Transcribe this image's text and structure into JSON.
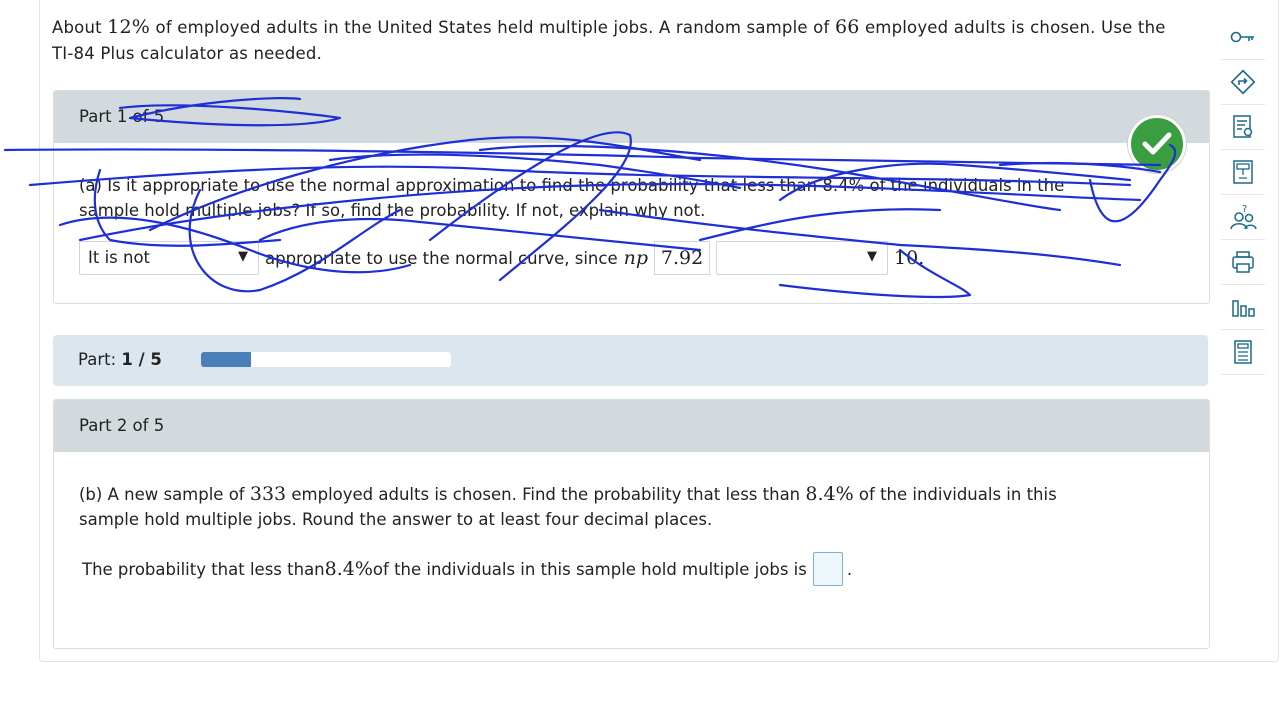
{
  "problem": {
    "intro_a": "About ",
    "pct": "12%",
    "intro_b": " of employed adults in the United States held multiple jobs. A random sample of ",
    "n": "66",
    "intro_c": " employed adults is chosen. Use the",
    "intro_d": "TI-84 Plus calculator as needed."
  },
  "part1": {
    "header": "Part 1 of 5",
    "question_line1": "(a) Is it appropriate to use the normal approximation to find the probability that less than 8.4% of the individuals in the",
    "question_line2": "sample hold multiple jobs? If so, find the probability. If not, explain why not.",
    "select_value": "It is not",
    "answer_text": "appropriate to use the normal curve, since",
    "math_np": "np",
    "np_value": "7.92",
    "compare_value": "10."
  },
  "progress": {
    "label": "Part:",
    "value": "1 / 5",
    "fraction": 0.2
  },
  "part2": {
    "header": "Part 2 of 5",
    "q_a": "(b) A new sample of ",
    "q_n": "333",
    "q_b": " employed adults is chosen. Find the probability that less than ",
    "q_pct": "8.4%",
    "q_c": " of the individuals in this",
    "q_d": "sample hold multiple jobs. Round the answer to at least four decimal places.",
    "ans_a": "The probability that less than ",
    "ans_pct": "8.4%",
    "ans_b": " of the individuals in this sample hold multiple jobs is",
    "ans_end": "."
  },
  "sidebar": {
    "icons": [
      "key-icon",
      "directions-icon",
      "reading-icon",
      "calculator-book-icon",
      "help-people-icon",
      "printer-icon",
      "bar-chart-icon",
      "calculator-icon"
    ]
  },
  "colors": {
    "header_bg": "#d2dade",
    "progress_bg": "#dbe6ef",
    "progress_fill": "#4a7fb8",
    "check_green": "#3a9d3f",
    "ink_blue": "#1f2fd6"
  }
}
